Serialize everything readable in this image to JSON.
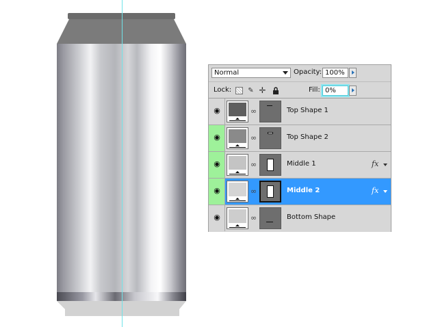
{
  "layers_panel": {
    "blend_mode": "Normal",
    "opacity_label": "Opacity:",
    "opacity_value": "100%",
    "lock_label": "Lock:",
    "fill_label": "Fill:",
    "fill_value": "0%",
    "layers": [
      {
        "name": "Top Shape 1",
        "visible": true,
        "selected": false,
        "fx": ""
      },
      {
        "name": "Top Shape 2",
        "visible": true,
        "selected": false,
        "fx": ""
      },
      {
        "name": "Middle 1",
        "visible": true,
        "selected": false,
        "fx": "fx"
      },
      {
        "name": "Middle 2",
        "visible": true,
        "selected": true,
        "fx": "fx"
      },
      {
        "name": "Bottom Shape",
        "visible": true,
        "selected": false,
        "fx": ""
      }
    ]
  },
  "colors": {
    "selection": "#3399ff",
    "visibility_highlight": "#9ef19a",
    "guide": "#6fe3e8"
  },
  "icons": [
    "eye-icon",
    "chain-icon",
    "lock-transparent-icon",
    "lock-brush-icon",
    "lock-move-icon",
    "lock-all-icon",
    "fx-icon"
  ]
}
